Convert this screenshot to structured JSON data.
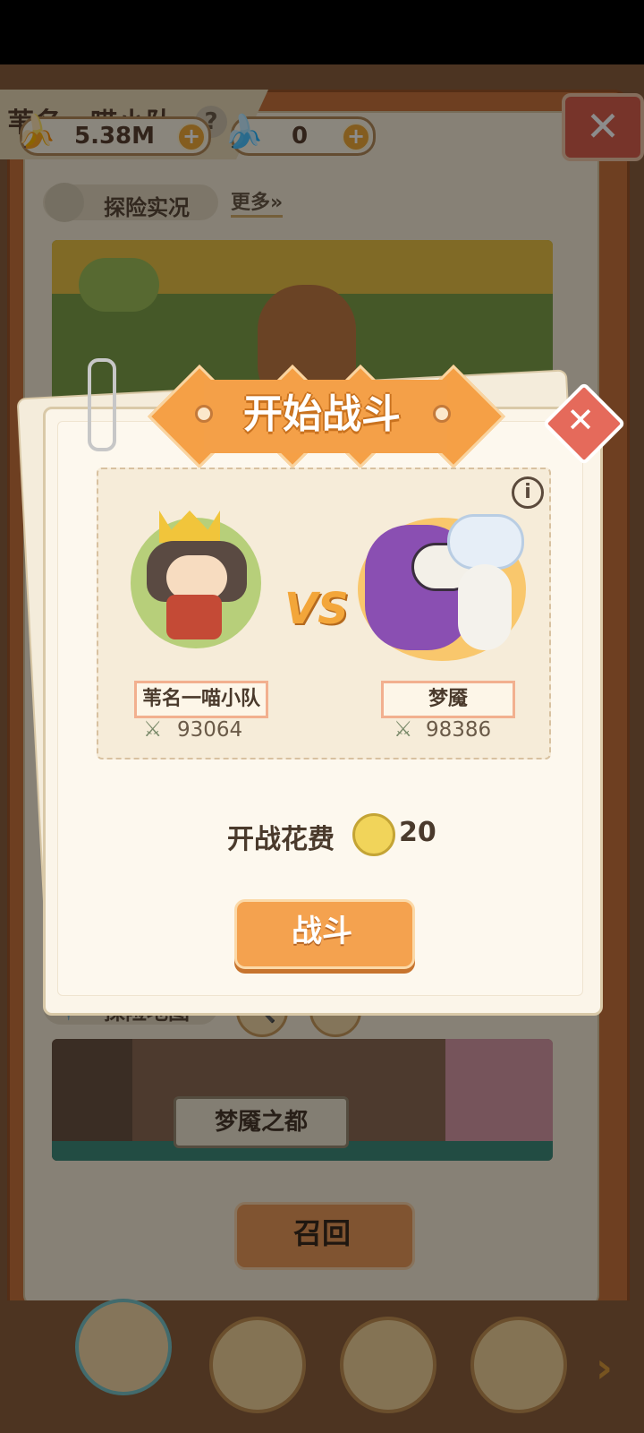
{
  "header": {
    "team_title": "苇名一喵小队",
    "help_icon": "?",
    "bananas": "5.38M",
    "premium_bananas": "0",
    "plus": "+",
    "close": "✕"
  },
  "sections": {
    "live_label": "探险实况",
    "more_label": "更多»",
    "map_label": "探险地图",
    "map_location": "梦魇之都",
    "recall_label": "召回"
  },
  "modal": {
    "title": "开始战斗",
    "close": "✕",
    "info": "i",
    "vs": "VS",
    "player": {
      "name": "苇名一喵小队",
      "power": "93064"
    },
    "enemy": {
      "name": "梦魇",
      "power": "98386"
    },
    "cost_label": "开战花费",
    "cost_value": "20",
    "fight_label": "战斗"
  },
  "colors": {
    "accent_orange": "#f4a048",
    "close_red": "#e56a5b",
    "page_bg": "#fbf5e9"
  },
  "icons": [
    "banana-icon",
    "blue-banana-icon",
    "flag-icon",
    "map-pin-icon",
    "magnifier-icon",
    "sword-icon",
    "clover-icon",
    "info-icon",
    "close-icon"
  ]
}
